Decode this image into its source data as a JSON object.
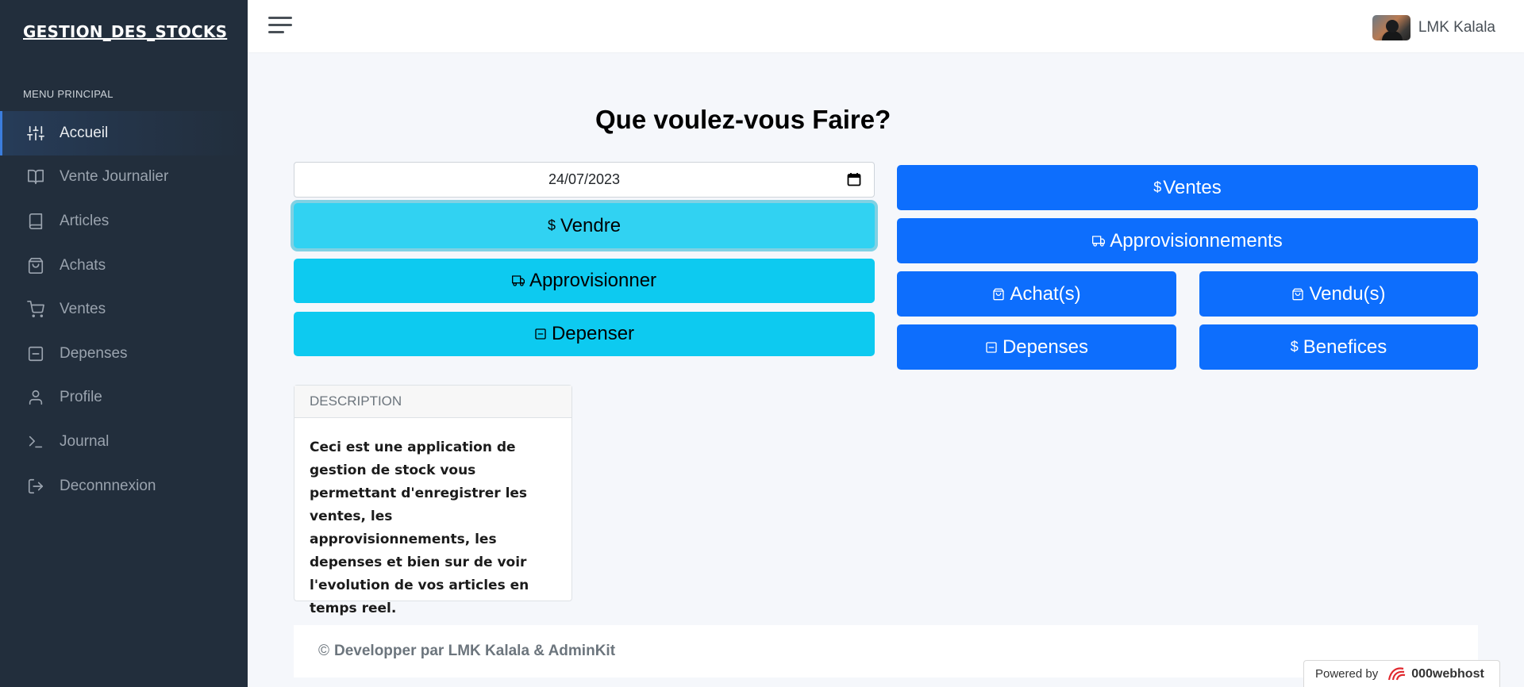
{
  "sidebar": {
    "brand": "GESTION_DES_STOCKS",
    "menu_header": "MENU PRINCIPAL",
    "items": [
      {
        "label": "Accueil",
        "icon": "sliders-icon"
      },
      {
        "label": "Vente Journalier",
        "icon": "book-open-icon"
      },
      {
        "label": "Articles",
        "icon": "book-icon"
      },
      {
        "label": "Achats",
        "icon": "shopping-bag-icon"
      },
      {
        "label": "Ventes",
        "icon": "shopping-cart-icon"
      },
      {
        "label": "Depenses",
        "icon": "minus-square-icon"
      },
      {
        "label": "Profile",
        "icon": "user-icon"
      },
      {
        "label": "Journal",
        "icon": "terminal-icon"
      },
      {
        "label": "Deconnnexion",
        "icon": "log-out-icon"
      }
    ],
    "active_index": 0
  },
  "topbar": {
    "user_name": "LMK Kalala"
  },
  "main": {
    "heading_bold": "Que voulez-vous",
    "heading_rest": " Faire?",
    "date_value": "24/07/2023",
    "actions": {
      "vendre": "Vendre",
      "approvisionner": "Approvisionner",
      "depenser": "Depenser"
    },
    "reports": {
      "ventes": "Ventes",
      "approvisionnements": "Approvisionnements",
      "achats": "Achat(s)",
      "vendus": "Vendu(s)",
      "depenses": "Depenses",
      "benefices": "Benefices"
    },
    "description": {
      "header": "DESCRIPTION",
      "body": "Ceci est une application de gestion de stock vous permettant d'enregistrer les ventes, les approvisionnements, les depenses et bien sur de voir l'evolution de vos articles en temps reel."
    }
  },
  "footer": {
    "copyright": "©",
    "text": "Developper par LMK Kalala & AdminKit"
  },
  "powered": {
    "label": "Powered by",
    "brand": "000webhost"
  },
  "colors": {
    "sidebar_bg": "#222e3c",
    "info": "#0dcaf0",
    "primary": "#0d6efd",
    "active_accent": "#3b7ddd"
  }
}
